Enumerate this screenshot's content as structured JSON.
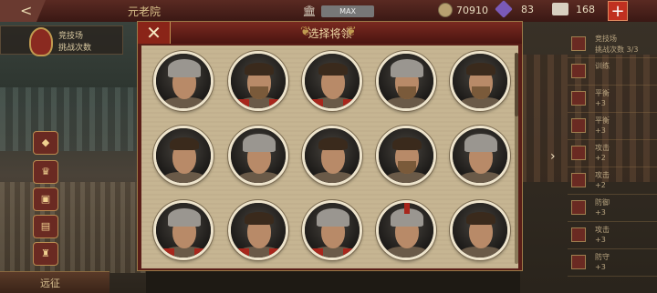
{
  "topbar": {
    "back_label": "<",
    "title": "元老院",
    "max_label": "MAX",
    "coins": "70910",
    "gems": "83",
    "scrolls": "168",
    "plus_label": "+"
  },
  "left_panel": {
    "line1": "竞技场",
    "line2": "挑战次数",
    "bottom_button": "远征"
  },
  "right_panel": {
    "items": [
      {
        "l1": "竞技场",
        "l2": "挑战次数 3/3"
      },
      {
        "l1": "训练",
        "l2": ""
      },
      {
        "l1": "平衡",
        "l2": "+3"
      },
      {
        "l1": "平衡",
        "l2": "+3"
      },
      {
        "l1": "攻击",
        "l2": "+2"
      },
      {
        "l1": "攻击",
        "l2": "+2"
      },
      {
        "l1": "防御",
        "l2": "+3"
      },
      {
        "l1": "攻击",
        "l2": "+3"
      },
      {
        "l1": "防守",
        "l2": "+3"
      }
    ]
  },
  "dialog": {
    "title": "选择将领",
    "close_label": "✕"
  },
  "portraits": [
    {
      "name": "commander-portrait-1",
      "style": "helm"
    },
    {
      "name": "commander-portrait-2",
      "style": "hair-beard-red"
    },
    {
      "name": "commander-portrait-3",
      "style": "hair-cape"
    },
    {
      "name": "commander-portrait-4",
      "style": "horned-beard"
    },
    {
      "name": "commander-portrait-5",
      "style": "hair-beard"
    },
    {
      "name": "commander-portrait-6",
      "style": "hair"
    },
    {
      "name": "commander-portrait-7",
      "style": "helm"
    },
    {
      "name": "commander-portrait-8",
      "style": "hair-female"
    },
    {
      "name": "commander-portrait-9",
      "style": "hair-beard"
    },
    {
      "name": "commander-portrait-10",
      "style": "helm"
    },
    {
      "name": "commander-portrait-11",
      "style": "helm-cape"
    },
    {
      "name": "commander-portrait-12",
      "style": "hair-cape"
    },
    {
      "name": "commander-portrait-13",
      "style": "helm-cape"
    },
    {
      "name": "commander-portrait-14",
      "style": "helm-crest"
    },
    {
      "name": "commander-portrait-15",
      "style": "hair"
    }
  ],
  "colors": {
    "accent_red": "#8a2418",
    "parchment": "#c6b592",
    "gold": "#c09a50"
  }
}
